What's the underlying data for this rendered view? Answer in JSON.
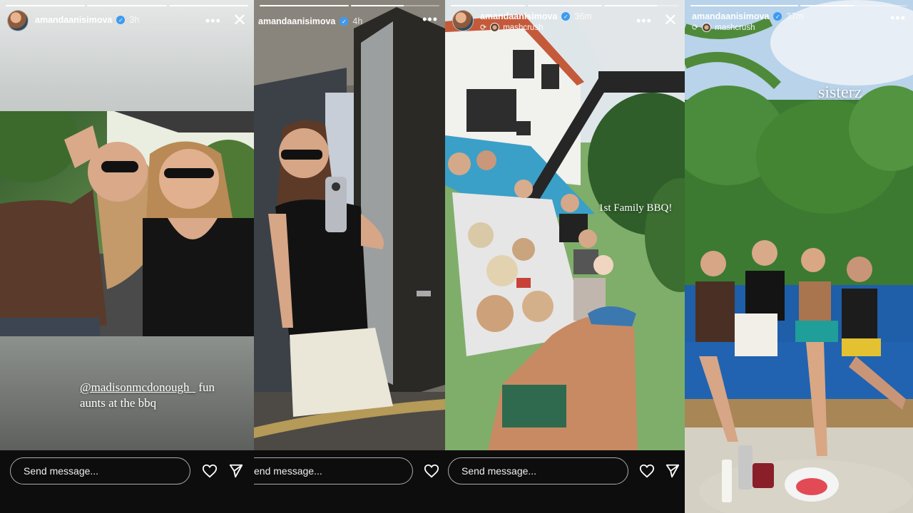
{
  "stories": [
    {
      "username": "amandaanisimova",
      "time": "3h",
      "caption_mention": "@madisonmcdonough_",
      "caption_rest": " fun",
      "caption_line2": "aunts at the bbq",
      "message_placeholder": "Send message...",
      "progress_fill": 1.0
    },
    {
      "username": "amandaanisimova",
      "time": "4h",
      "message_placeholder": "end message...",
      "progress_fill": 0.6
    },
    {
      "username": "amandaanisimova",
      "time": "36m",
      "repost_from": "mashcrush",
      "caption": "1st Family BBQ!",
      "message_placeholder": "Send message...",
      "progress_fill": 0.7
    },
    {
      "username": "amandaanisimova",
      "time": "37m",
      "repost_from": "mashcrush",
      "caption": "sisterz",
      "progress_fill": 0.5
    }
  ],
  "icons": {
    "verified": "verified-badge-icon",
    "more": "more-options-icon",
    "close": "close-icon",
    "heart": "heart-icon",
    "send": "send-icon",
    "repost": "repost-icon"
  },
  "colors": {
    "verified": "#3d9bf0",
    "footer_bg": "#0d0d0d"
  }
}
